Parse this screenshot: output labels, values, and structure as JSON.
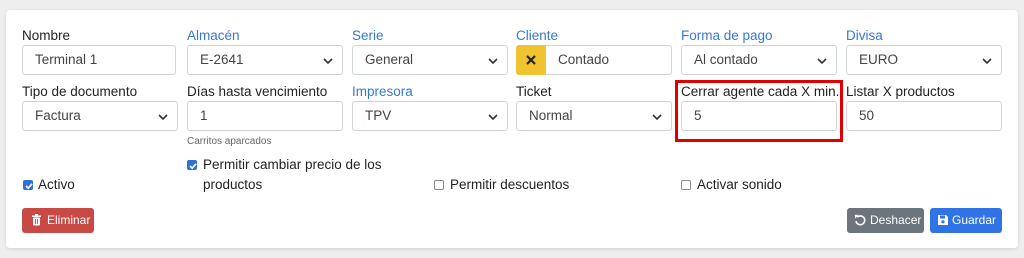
{
  "form": {
    "nombre": {
      "label": "Nombre",
      "value": "Terminal 1"
    },
    "almacen": {
      "label": "Almacén",
      "value": "E-2641"
    },
    "serie": {
      "label": "Serie",
      "value": "General"
    },
    "cliente": {
      "label": "Cliente",
      "value": "Contado"
    },
    "forma_pago": {
      "label": "Forma de pago",
      "value": "Al contado"
    },
    "divisa": {
      "label": "Divisa",
      "value": "EURO"
    },
    "tipo_documento": {
      "label": "Tipo de documento",
      "value": "Factura"
    },
    "dias_vencimiento": {
      "label": "Días hasta vencimiento",
      "value": "1",
      "help": "Carritos aparcados"
    },
    "impresora": {
      "label": "Impresora",
      "value": "TPV"
    },
    "ticket": {
      "label": "Ticket",
      "value": "Normal"
    },
    "cerrar_agente": {
      "label": "Cerrar agente cada X min.",
      "value": "5"
    },
    "listar_productos": {
      "label": "Listar X productos",
      "value": "50"
    }
  },
  "checkboxes": {
    "activo": {
      "label": "Activo",
      "checked": true
    },
    "cambiar_precio": {
      "label_line1": "Permitir cambiar precio de los",
      "label_line2": "productos",
      "checked": true
    },
    "descuentos": {
      "label": "Permitir descuentos",
      "checked": false
    },
    "sonido": {
      "label": "Activar sonido",
      "checked": false
    }
  },
  "buttons": {
    "eliminar": "Eliminar",
    "deshacer": "Deshacer",
    "guardar": "Guardar"
  },
  "colors": {
    "link_label": "#3778d6",
    "clear_button": "#f0c330",
    "danger": "#c94a44",
    "secondary": "#6c757d",
    "primary": "#2f73e6",
    "highlight": "#e00000"
  },
  "icons": {
    "clear": "x-icon",
    "delete": "trash-icon",
    "undo": "undo-icon",
    "save": "floppy-icon",
    "select": "chevron-down-icon"
  }
}
